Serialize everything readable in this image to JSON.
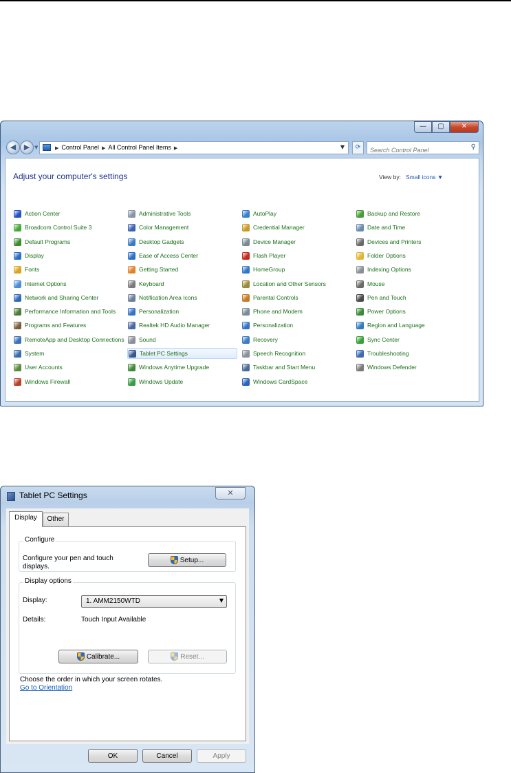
{
  "control_panel": {
    "caption_buttons": {
      "minimize": "—",
      "maximize": "▢",
      "close": "✕"
    },
    "nav": {
      "back_glyph": "◀",
      "forward_glyph": "▶"
    },
    "address": {
      "crumbs": [
        "Control Panel",
        "All Control Panel Items"
      ],
      "separator": "▶",
      "dropdown": "▼",
      "refresh": "⟳"
    },
    "search": {
      "placeholder": "Search Control Panel",
      "icon": "⚲"
    },
    "heading": "Adjust your computer's settings",
    "view_by_label": "View by:",
    "view_by_value": "Small icons ▼",
    "items": [
      {
        "label": "Action Center",
        "icon": "flag-icon",
        "color": "#2452c7"
      },
      {
        "label": "Broadcom Control Suite 3",
        "icon": "broadcom-icon",
        "color": "#47a83a"
      },
      {
        "label": "Default Programs",
        "icon": "default-programs-icon",
        "color": "#3b8d2e"
      },
      {
        "label": "Display",
        "icon": "display-icon",
        "color": "#2b6fc1"
      },
      {
        "label": "Fonts",
        "icon": "fonts-icon",
        "color": "#d9a521"
      },
      {
        "label": "Internet Options",
        "icon": "internet-icon",
        "color": "#4c8bd6"
      },
      {
        "label": "Network and Sharing Center",
        "icon": "network-icon",
        "color": "#2f6ab5"
      },
      {
        "label": "Performance Information and Tools",
        "icon": "performance-icon",
        "color": "#4b7a3a"
      },
      {
        "label": "Programs and Features",
        "icon": "programs-icon",
        "color": "#7a5e3a"
      },
      {
        "label": "RemoteApp and Desktop Connections",
        "icon": "remoteapp-icon",
        "color": "#3a72b8"
      },
      {
        "label": "System",
        "icon": "system-icon",
        "color": "#386bb0"
      },
      {
        "label": "User Accounts",
        "icon": "users-icon",
        "color": "#5a8a3a"
      },
      {
        "label": "Windows Firewall",
        "icon": "firewall-icon",
        "color": "#b8422b"
      },
      {
        "label": "Administrative Tools",
        "icon": "admin-tools-icon",
        "color": "#8895a6"
      },
      {
        "label": "Color Management",
        "icon": "color-mgmt-icon",
        "color": "#3d63b0"
      },
      {
        "label": "Desktop Gadgets",
        "icon": "gadgets-icon",
        "color": "#3a7bc0"
      },
      {
        "label": "Ease of Access Center",
        "icon": "ease-icon",
        "color": "#2a6fc9"
      },
      {
        "label": "Getting Started",
        "icon": "getting-started-icon",
        "color": "#e0822b"
      },
      {
        "label": "Keyboard",
        "icon": "keyboard-icon",
        "color": "#7a7a7a"
      },
      {
        "label": "Notification Area Icons",
        "icon": "notification-icon",
        "color": "#6a7f99"
      },
      {
        "label": "Personalization",
        "icon": "personalization-icon",
        "color": "#3672c2"
      },
      {
        "label": "Realtek HD Audio Manager",
        "icon": "realtek-icon",
        "color": "#4a66a8"
      },
      {
        "label": "Sound",
        "icon": "sound-icon",
        "color": "#8a8f99"
      },
      {
        "label": "Tablet PC Settings",
        "icon": "tablet-icon",
        "color": "#34598f"
      },
      {
        "label": "Windows Anytime Upgrade",
        "icon": "upgrade-icon",
        "color": "#3e8a3a"
      },
      {
        "label": "Windows Update",
        "icon": "update-icon",
        "color": "#3a9a4a"
      },
      {
        "label": "AutoPlay",
        "icon": "autoplay-icon",
        "color": "#3b7fc8"
      },
      {
        "label": "Credential Manager",
        "icon": "credential-icon",
        "color": "#c79a2a"
      },
      {
        "label": "Device Manager",
        "icon": "device-manager-icon",
        "color": "#7d8894"
      },
      {
        "label": "Flash Player",
        "icon": "flash-icon",
        "color": "#c42a1f"
      },
      {
        "label": "HomeGroup",
        "icon": "homegroup-icon",
        "color": "#2f78c8"
      },
      {
        "label": "Location and Other Sensors",
        "icon": "sensors-icon",
        "color": "#9a8a3a"
      },
      {
        "label": "Parental Controls",
        "icon": "parental-icon",
        "color": "#c37a2a"
      },
      {
        "label": "Phone and Modem",
        "icon": "phone-icon",
        "color": "#7a8a99"
      },
      {
        "label": "Personalization",
        "icon": "personalization-icon",
        "color": "#3672c2"
      },
      {
        "label": "Recovery",
        "icon": "recovery-icon",
        "color": "#3a7bc0"
      },
      {
        "label": "Speech Recognition",
        "icon": "speech-icon",
        "color": "#8a8f99"
      },
      {
        "label": "Taskbar and Start Menu",
        "icon": "taskbar-icon",
        "color": "#4a6a99"
      },
      {
        "label": "Windows CardSpace",
        "icon": "cardspace-icon",
        "color": "#2a64b8"
      },
      {
        "label": "Backup and Restore",
        "icon": "backup-icon",
        "color": "#4a9a3a"
      },
      {
        "label": "Date and Time",
        "icon": "clock-icon",
        "color": "#6a8ab0"
      },
      {
        "label": "Devices and Printers",
        "icon": "printer-icon",
        "color": "#6a6a6a"
      },
      {
        "label": "Folder Options",
        "icon": "folder-icon",
        "color": "#e0b53a"
      },
      {
        "label": "Indexing Options",
        "icon": "indexing-icon",
        "color": "#8a8f99"
      },
      {
        "label": "Mouse",
        "icon": "mouse-icon",
        "color": "#6a6a6a"
      },
      {
        "label": "Pen and Touch",
        "icon": "pen-icon",
        "color": "#4a4a4a"
      },
      {
        "label": "Power Options",
        "icon": "power-icon",
        "color": "#3a8a3a"
      },
      {
        "label": "Region and Language",
        "icon": "region-icon",
        "color": "#2f7ac0"
      },
      {
        "label": "Sync Center",
        "icon": "sync-icon",
        "color": "#3aa03a"
      },
      {
        "label": "Troubleshooting",
        "icon": "troubleshooting-icon",
        "color": "#3a6ab0"
      },
      {
        "label": "Windows Defender",
        "icon": "defender-icon",
        "color": "#7a7a7a"
      }
    ],
    "highlighted_item": "Tablet PC Settings"
  },
  "tablet_dialog": {
    "title": "Tablet PC Settings",
    "close_glyph": "✕",
    "tabs": [
      {
        "label": "Display",
        "active": true
      },
      {
        "label": "Other",
        "active": false
      }
    ],
    "configure": {
      "title": "Configure",
      "text_line1": "Configure your pen and touch",
      "text_line2": "displays.",
      "setup_button": "Setup..."
    },
    "display_options": {
      "title": "Display options",
      "display_label": "Display:",
      "display_value": "1. AMM2150WTD",
      "dropdown_arrow": "▼",
      "details_label": "Details:",
      "details_value": "Touch Input Available",
      "calibrate_button": "Calibrate...",
      "reset_button": "Reset..."
    },
    "orientation_text": "Choose the order in which your screen rotates.",
    "orientation_link": "Go to Orientation",
    "ok_button": "OK",
    "cancel_button": "Cancel",
    "apply_button": "Apply"
  }
}
